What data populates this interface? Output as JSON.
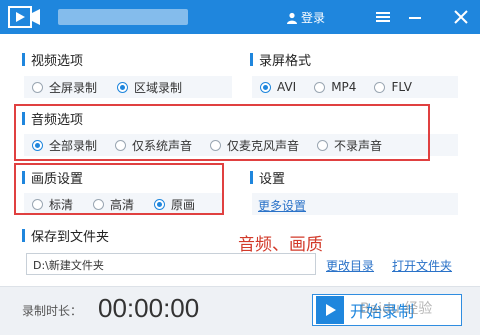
{
  "titlebar": {
    "app_title": "",
    "login_label": "登录"
  },
  "video": {
    "title": "视频选项",
    "options": [
      {
        "label": "全屏录制",
        "selected": false
      },
      {
        "label": "区域录制",
        "selected": true
      }
    ]
  },
  "format": {
    "title": "录屏格式",
    "options": [
      {
        "label": "AVI",
        "selected": true
      },
      {
        "label": "MP4",
        "selected": false
      },
      {
        "label": "FLV",
        "selected": false
      }
    ]
  },
  "audio": {
    "title": "音频选项",
    "options": [
      {
        "label": "全部录制",
        "selected": true
      },
      {
        "label": "仅系统声音",
        "selected": false
      },
      {
        "label": "仅麦克风声音",
        "selected": false
      },
      {
        "label": "不录声音",
        "selected": false
      }
    ]
  },
  "quality": {
    "title": "画质设置",
    "options": [
      {
        "label": "标清",
        "selected": false
      },
      {
        "label": "高清",
        "selected": false
      },
      {
        "label": "原画",
        "selected": true
      }
    ]
  },
  "settings": {
    "title": "设置",
    "more_link": "更多设置"
  },
  "save": {
    "title": "保存到文件夹",
    "path": "D:\\新建文件夹",
    "change_link": "更改目录",
    "open_link": "打开文件夹"
  },
  "annotation": "音频、画质",
  "bottom": {
    "duration_label": "录制时长：",
    "timer": "00:00:00",
    "start_label": "开始录制"
  },
  "watermark": "Baidu 经验"
}
